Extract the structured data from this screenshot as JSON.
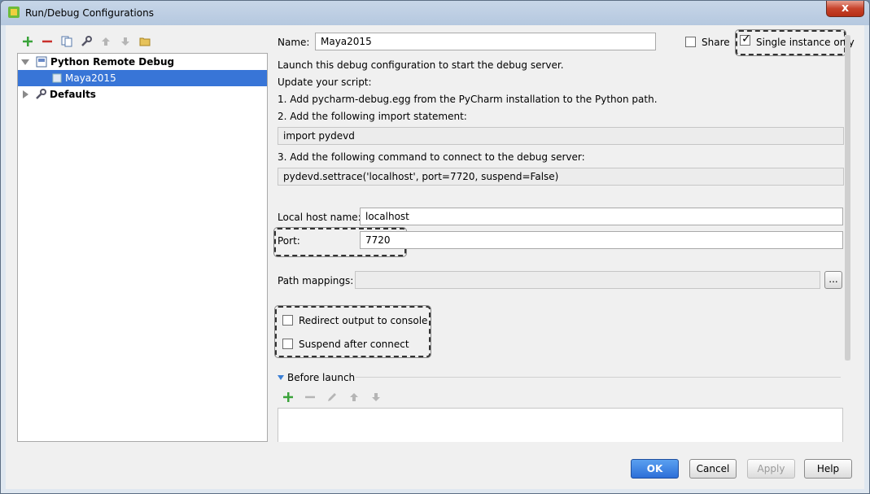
{
  "window": {
    "title": "Run/Debug Configurations",
    "close_label": "x"
  },
  "left_toolbar": {
    "icons": [
      "add-icon",
      "remove-icon",
      "copy-icon",
      "wrench-icon",
      "move-up-icon",
      "move-down-icon",
      "folder-icon"
    ]
  },
  "tree": {
    "group_label": "Python Remote Debug",
    "selected_item": "Maya2015",
    "defaults_label": "Defaults"
  },
  "form": {
    "name_label": "Name:",
    "name_value": "Maya2015",
    "share_label": "Share",
    "share_checked": false,
    "single_instance_label": "Single instance only",
    "single_instance_checked": true,
    "line1": "Launch this debug configuration to start the debug server.",
    "line2": "Update your script:",
    "line3": "1. Add pycharm-debug.egg from the PyCharm installation to the Python path.",
    "line4": "2. Add the following import statement:",
    "import_code": "import pydevd",
    "line5": "3. Add the following command to connect to the debug server:",
    "settrace_code": "pydevd.settrace('localhost', port=7720, suspend=False)",
    "local_host_label": "Local host name:",
    "local_host_value": "localhost",
    "port_label": "Port:",
    "port_value": "7720",
    "path_mappings_label": "Path mappings:",
    "path_mappings_value": "",
    "browse_label": "...",
    "redirect_label": "Redirect output to console",
    "redirect_checked": false,
    "suspend_label": "Suspend after connect",
    "suspend_checked": false,
    "before_launch_label": "Before launch"
  },
  "buttons": {
    "ok": "OK",
    "cancel": "Cancel",
    "apply": "Apply",
    "help": "Help"
  }
}
